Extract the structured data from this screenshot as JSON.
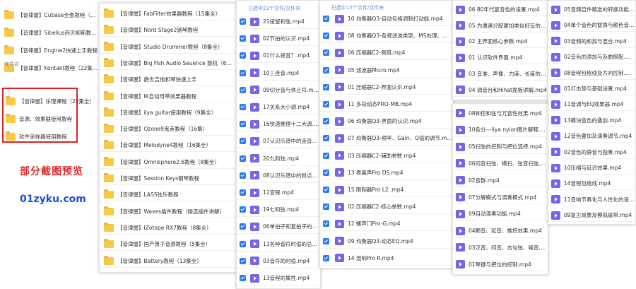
{
  "panel1": {
    "top_items": [
      "【音律屋】Cubase全套教程（105集）",
      "【音律屋】Sibelius西贝柳斯教程（10集全）",
      "【音律屋】Engine2快速上手教程",
      "【音律屋】Kontakt教程（22集全）"
    ],
    "header": "文件名",
    "boxed_items": [
      "【音律屋】乐理课程（22集全）",
      "音源、效果器使用教程",
      "软件采样器使用教程"
    ],
    "promo": "部分截图预览",
    "site": "01zyku.com"
  },
  "panel2": {
    "items": [
      "【音律屋】FabFilter效果器教程（15集全）",
      "【音律屋】Nord Stage2钢琴教程",
      "【音律屋】Studio Drummer教程（8集全）",
      "【音律屋】Big Fish Audio Seuence 鼓机（6集全）",
      "【音律屋】爵世吉他和琴快速上手",
      "【音律屋】IK自动母带效果器教程",
      "【音律屋】ilya guitar使用教程（9集全）",
      "【音律屋】Ozone9鬼差教程（16集）",
      "【音律屋】Melodyne4教程（16集全）",
      "【音律屋】Omnisphere2.6教程（8集全）",
      "【音律屋】Session Keys钢琴教程",
      "【音律屋】LASS弦乐教程",
      "【音律屋】Waves插件教程（精选插件讲解）",
      "【音律屋】IZotope RX7教程（8集全）",
      "【音律屋】国产箫子音源教程（5集全）",
      "【音律屋】Battery教程（13集全）"
    ]
  },
  "panel3": {
    "header": "已选中22个文件/文件夹",
    "items": [
      "21扭留和弦.mp4",
      "02节拍的认识.mp4",
      "01什么是音？.mp4",
      "10三连音.mp4",
      "09切分音与休止符.mp4",
      "17关系大小调.mp4",
      "16快速推理十二大调.mp4",
      "07认识乐谱中的连音线.mp4",
      "20九和弦.mp4",
      "08认识乐谱中的附点音符.mp4",
      "12音程.mp4",
      "19七和弦.mp4",
      "06单拍子和复拍子的区别.mp4",
      "11各种音符时值的总结.mp4",
      "03音符的时值.mp4",
      "13音程的属性.mp4"
    ]
  },
  "panel4": {
    "header": "已选中15个文件/文件夹",
    "items": [
      "10 均衡器Q3-自动包络调制打动能.mp4",
      "08 均衡器Q3-各频滤波类型、MS处理、自动增益.mp4",
      "06 压缩器C2-侧链.mp4",
      "05 滤波器Micro.mp4",
      "01 压缩器C2-界面认识.mp4",
      "11 多段动态PRO-MB.mp4",
      "06 均衡器Q3-界面的认识.mp4",
      "07 均衡器Q3-频率、Gain、Q值的调节.mp4",
      "03 压缩器C2-辅助参数.mp4",
      "13 表离声Pro DS.mp4",
      "15 限制器Pro L2 .mp4",
      "02 压缩器C2-核心参数.mp4",
      "12 螺声门Pro-G.mp4",
      "09 均衡器Q3-动态EQ.mp4",
      "14 混响Pro R.mp4"
    ]
  },
  "panel5": {
    "top_items": [
      "06 80年代复音色的设置.mp4",
      "05 为遭遇分配更加类似好玩的音色.mp4",
      "02 主界面核心参数.mp4",
      "01 认识软件界面.mp4",
      "03 音准、声像、力度、长度的调编.mp4",
      "04 调音台和Hihat面板讲解.mp4"
    ],
    "bottom_items": [
      "08钟控和弦与冗音性效果.mp4",
      "10各分---ilya nylon图片解释.mp4",
      "05扫弦的控制与把位选择.mp4",
      "06闷音扫弦、模扫、弦音扫弦.mp4",
      "02音群.mp4",
      "07分解模式与演奏模式.mp4",
      "09自动演奏功能.mp4",
      "04颤音、延音、推挖效果.mp4",
      "03泛音、闷音、击勾弦、噪音.mp4",
      "01琴键与把位的控制.mp4"
    ]
  },
  "panel6": {
    "items": [
      "05音频启件精准的转换功能.mp4",
      "04单个音色的替换与颜色音定义.mp4",
      "03音频的和加与混合.mp4",
      "02音色的添加与及曲搭配.mp4",
      "08音程包络线及方向控制.mp4",
      "01打击垫与基础设置.mp4",
      "11音调与EQ效果器.mp4",
      "13模块音色的叠加.mp4",
      "12音色叠加及演奏调节.mp4",
      "02音色的静音与独奏.mp4",
      "10压缩与延迟效果.mp4",
      "14音程包络线.mp4",
      "11音响节奏化与人性化的设置.mp4",
      "09复古效果及模拟磁带.mp4"
    ]
  }
}
